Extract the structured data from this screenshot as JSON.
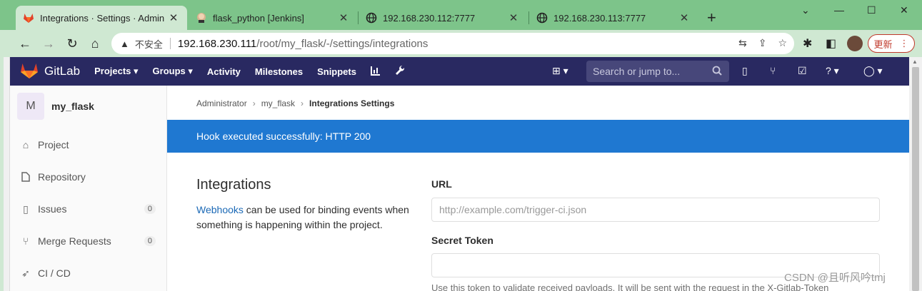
{
  "browser": {
    "tabs": [
      {
        "title": "Integrations · Settings · Admin",
        "icon": "gitlab-favicon",
        "active": true
      },
      {
        "title": "flask_python [Jenkins]",
        "icon": "jenkins-favicon",
        "active": false
      },
      {
        "title": "192.168.230.112:7777",
        "icon": "globe-icon",
        "active": false
      },
      {
        "title": "192.168.230.113:7777",
        "icon": "globe-icon",
        "active": false
      }
    ],
    "new_tab": "+",
    "address": {
      "security_label": "不安全",
      "host": "192.168.230.111",
      "path": "/root/my_flask/-/settings/integrations"
    },
    "update_label": "更新"
  },
  "gitlab": {
    "brand": "GitLab",
    "nav": [
      {
        "label": "Projects",
        "dropdown": true
      },
      {
        "label": "Groups",
        "dropdown": true
      },
      {
        "label": "Activity",
        "dropdown": false
      },
      {
        "label": "Milestones",
        "dropdown": false
      },
      {
        "label": "Snippets",
        "dropdown": false
      }
    ],
    "search_placeholder": "Search or jump to...",
    "colors": {
      "header": "#292961",
      "flash": "#1f78d1",
      "link": "#1b69b6"
    }
  },
  "sidebar": {
    "project_initial": "M",
    "project_name": "my_flask",
    "items": [
      {
        "label": "Project",
        "icon": "home-icon",
        "count": ""
      },
      {
        "label": "Repository",
        "icon": "doc-icon",
        "count": ""
      },
      {
        "label": "Issues",
        "icon": "issues-icon",
        "count": "0"
      },
      {
        "label": "Merge Requests",
        "icon": "merge-request-icon",
        "count": "0"
      },
      {
        "label": "CI / CD",
        "icon": "rocket-icon",
        "count": ""
      }
    ]
  },
  "breadcrumb": [
    "Administrator",
    "my_flask",
    "Integrations Settings"
  ],
  "flash_message": "Hook executed successfully: HTTP 200",
  "integrations": {
    "title": "Integrations",
    "desc_link": "Webhooks",
    "desc_rest": " can be used for binding events when something is happening within the project.",
    "url_label": "URL",
    "url_placeholder": "http://example.com/trigger-ci.json",
    "url_value": "",
    "token_label": "Secret Token",
    "token_value": "",
    "token_help": "Use this token to validate received payloads. It will be sent with the request in the X-Gitlab-Token"
  },
  "watermark": "CSDN @且听风吟tmj"
}
